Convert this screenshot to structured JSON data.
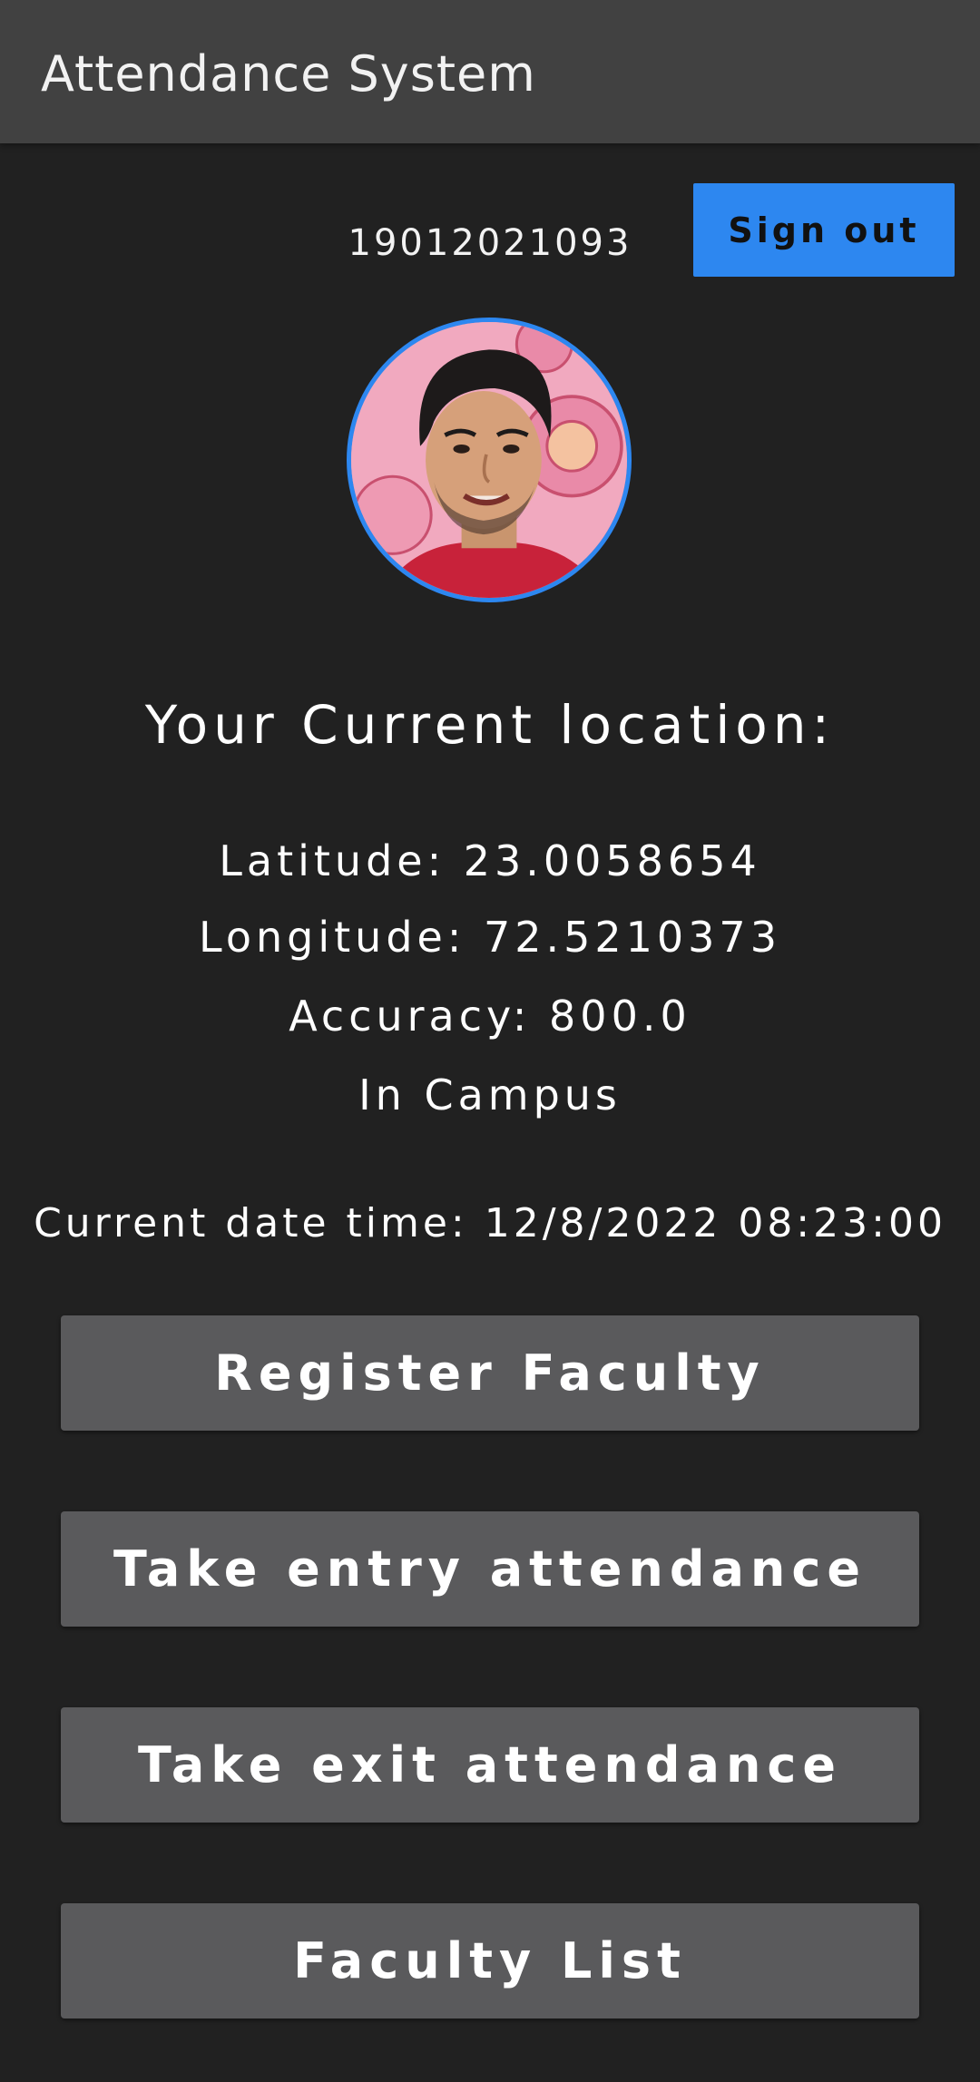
{
  "app_bar": {
    "title": "Attendance System"
  },
  "user": {
    "id": "19012021093",
    "sign_out_label": "Sign out",
    "avatar": "profile-photo"
  },
  "location": {
    "heading": "Your Current location:",
    "latitude": "Latitude: 23.0058654",
    "longitude": "Longitude: 72.5210373",
    "accuracy": "Accuracy: 800.0",
    "status": "In Campus"
  },
  "datetime": "Current date time: 12/8/2022 08:23:00",
  "actions": [
    {
      "label": "Register Faculty"
    },
    {
      "label": "Take entry attendance"
    },
    {
      "label": "Take exit attendance"
    },
    {
      "label": "Faculty List"
    }
  ],
  "colors": {
    "background": "#212121",
    "app_bar": "#414141",
    "accent": "#2d87f0",
    "button": "#5a5a5c"
  }
}
